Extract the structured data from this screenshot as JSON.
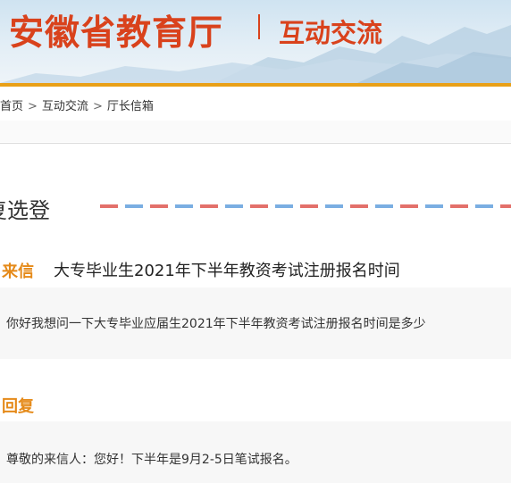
{
  "header": {
    "site_title": "安徽省教育厅",
    "section_title": "互动交流"
  },
  "breadcrumb": {
    "items": [
      "首页",
      "互动交流",
      "厅长信箱"
    ],
    "separator": ">"
  },
  "reply_section": {
    "title": "复选登"
  },
  "letter": {
    "label": "来信",
    "subject": "大专毕业生2021年下半年教资考试注册报名时间",
    "content": "你好我想问一下大专毕业应届生2021年下半年教资考试注册报名时间是多少"
  },
  "reply": {
    "label": "回复",
    "content": "尊敬的来信人：您好！下半年是9月2-5日笔试报名。"
  },
  "colors": {
    "brand_red": "#d9421c",
    "accent_orange": "#e9a018",
    "label_orange": "#e58a19"
  }
}
